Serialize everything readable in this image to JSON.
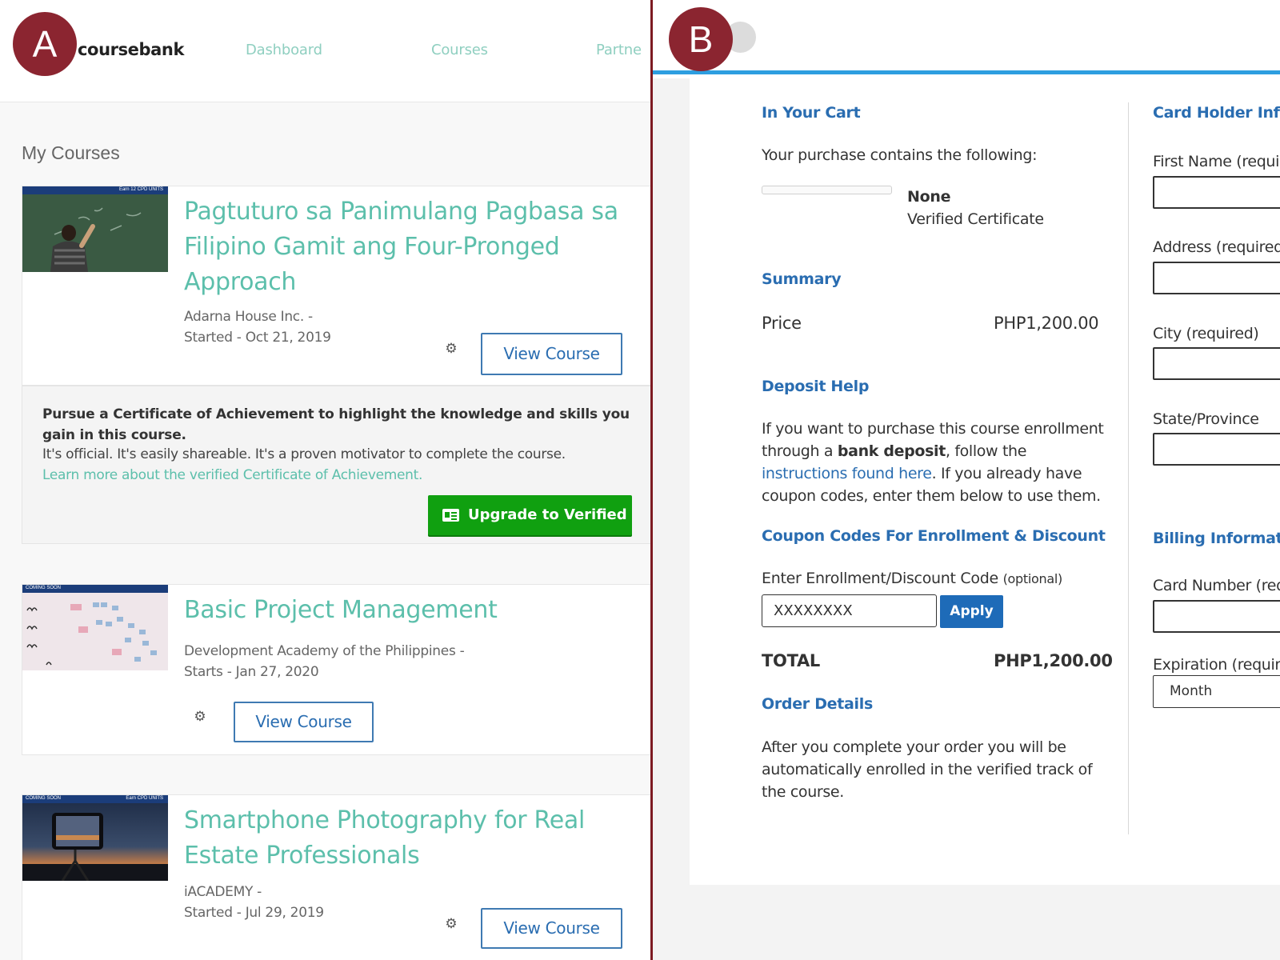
{
  "markers": {
    "a": "A",
    "b": "B"
  },
  "panel_a": {
    "logo": "coursebank",
    "nav": {
      "dashboard": "Dashboard",
      "courses": "Courses",
      "partners": "Partne"
    },
    "heading": "My Courses",
    "courses": [
      {
        "title": "Pagtuturo sa Panimulang Pagbasa sa Filipino Gamit ang Four-Pronged Approach",
        "org": "Adarna House Inc. -",
        "date": "Started - Oct 21, 2019",
        "button": "View Course",
        "thumb_ribbon": "Earn 12 CPD UNITS"
      },
      {
        "title": "Basic Project Management",
        "org": "Development Academy of the Philippines -",
        "date": "Starts - Jan 27, 2020",
        "button": "View Course",
        "thumb_ribbon": "COMING SOON"
      },
      {
        "title": "Smartphone Photography for Real Estate Professionals",
        "org": "iACADEMY -",
        "date": "Started - Jul 29, 2019",
        "button": "View Course",
        "thumb_ribbon": "COMING SOON",
        "thumb_ribbon_right": "Earn CPD UNITS"
      }
    ],
    "upsell": {
      "heading": "Pursue a Certificate of Achievement to highlight the knowledge and skills you gain in this course.",
      "text": "It's official. It's easily shareable. It's a proven motivator to complete the course.",
      "link": "Learn more about the verified Certificate of Achievement.",
      "button": "Upgrade to Verified"
    },
    "icons": {
      "gear": "gear-icon",
      "certificate": "certificate-icon"
    }
  },
  "panel_b": {
    "cart": {
      "heading": "In Your Cart",
      "intro": "Your purchase contains the following:",
      "item_name": "None",
      "item_type": "Verified Certificate"
    },
    "summary": {
      "heading": "Summary",
      "price_label": "Price",
      "price_value": "PHP1,200.00"
    },
    "deposit": {
      "heading": "Deposit Help",
      "text_1": "If you want to purchase this course enrollment through a ",
      "bold": "bank deposit",
      "text_2": ", follow the ",
      "link": "instructions found here",
      "text_3": ". If you already have coupon codes, enter them below to use them."
    },
    "coupon": {
      "heading": "Coupon Codes For Enrollment & Discount",
      "label": "Enter Enrollment/Discount Code",
      "optional": "(optional)",
      "value": "XXXXXXXX",
      "apply": "Apply"
    },
    "total": {
      "label": "TOTAL",
      "value": "PHP1,200.00"
    },
    "order": {
      "heading": "Order Details",
      "text": "After you complete your order you will be automatically enrolled in the verified track of the course."
    },
    "card_holder": {
      "heading": "Card Holder Informa",
      "first_name": "First Name (required)",
      "address": "Address (required)",
      "city": "City (required)",
      "state": "State/Province"
    },
    "billing": {
      "heading": "Billing Information",
      "card_number": "Card Number (requir",
      "expiration": "Expiration (required)",
      "month": "Month"
    }
  },
  "colors": {
    "accent_teal": "#5cbfab",
    "link_blue": "#2a6db1",
    "header_blue": "#2d9ee0",
    "upgrade_green": "#10a010",
    "marker_maroon": "#8b2530"
  }
}
